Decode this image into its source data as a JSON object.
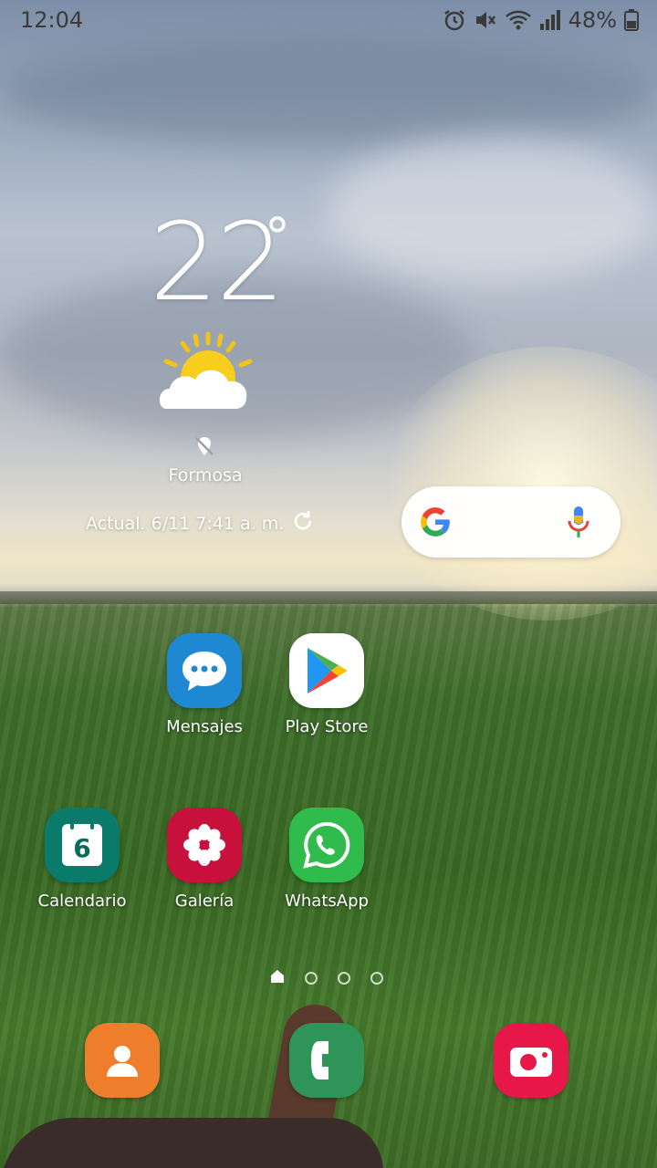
{
  "status_bar": {
    "time": "12:04",
    "battery": "48%",
    "icons": [
      "alarm-icon",
      "mute-icon",
      "wifi-icon",
      "signal-icon",
      "battery-icon"
    ]
  },
  "weather": {
    "temperature": "22",
    "degree": "°",
    "location": "Formosa",
    "updated": "Actual. 6/11 7:41 a. m.",
    "icon": "partly-sunny-icon"
  },
  "search": {
    "logo": "google-logo-icon",
    "mic": "mic-icon"
  },
  "apps": {
    "mensajes": "Mensajes",
    "play_store": "Play Store",
    "calendario": "Calendario",
    "calendar_day": "6",
    "galeria": "Galería",
    "whatsapp": "WhatsApp"
  },
  "dock": {
    "contacts": "contacts-icon",
    "phone": "phone-icon",
    "camera": "camera-icon"
  },
  "page_indicator": {
    "pages": 4,
    "current": 1
  },
  "colors": {
    "mensajes": "#1e88d2",
    "play_store": "#ffffff",
    "calendario": "#0a7a6a",
    "galeria": "#c8103d",
    "whatsapp": "#2fbc4c",
    "contacts": "#ee7d2c",
    "phone": "#2f9457",
    "camera": "#e8174a"
  }
}
